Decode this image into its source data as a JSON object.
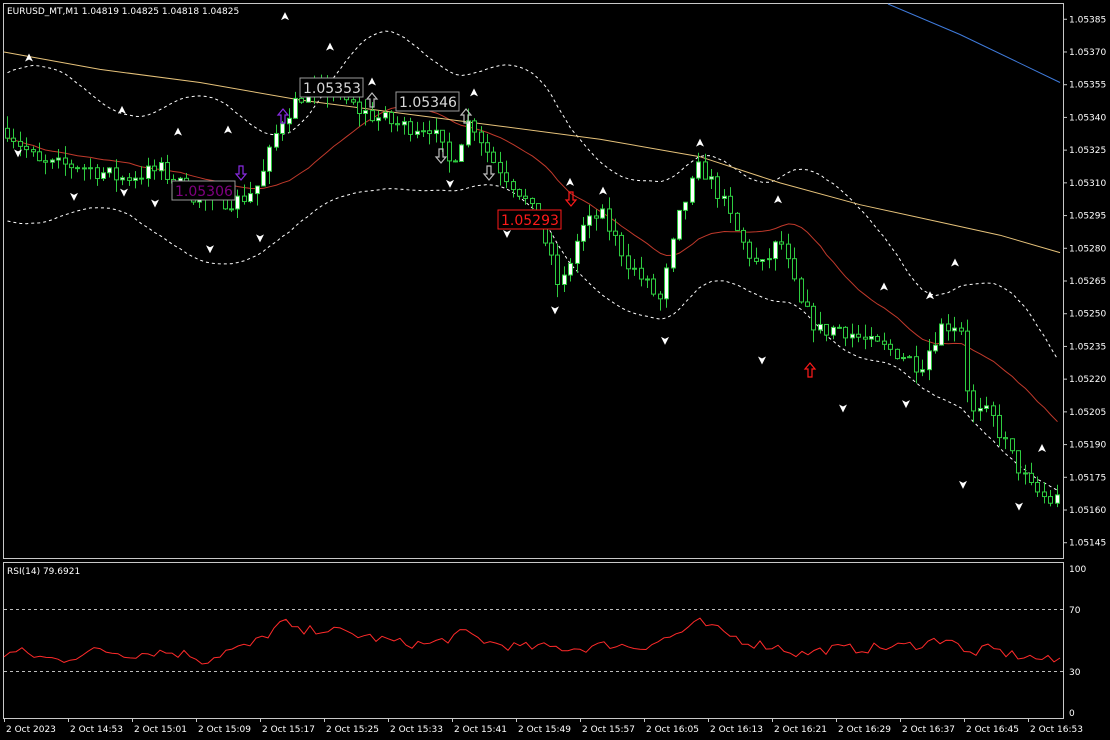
{
  "header": {
    "symbol_info": "EURUSD_MT,M1  1.04819 1.04825 1.04818 1.04825"
  },
  "main_chart": {
    "price_labels": [
      "1.05385",
      "1.05370",
      "1.05355",
      "1.05340",
      "1.05325",
      "1.05310",
      "1.05295",
      "1.05280",
      "1.05265",
      "1.05250",
      "1.05235",
      "1.05220",
      "1.05205",
      "1.05190",
      "1.05175",
      "1.05160",
      "1.05145"
    ],
    "price_range": [
      1.05138,
      1.05392
    ],
    "tags": [
      {
        "text": "1.05353",
        "price": 1.05353,
        "color": "#d8d8d8",
        "border": "#9a9a9a"
      },
      {
        "text": "1.05346",
        "price": 1.05346,
        "color": "#d8d8d8",
        "border": "#9a9a9a"
      },
      {
        "text": "1.05306",
        "price": 1.05306,
        "color": "#800080",
        "border": "#9a9a9a"
      },
      {
        "text": "1.05293",
        "price": 1.05293,
        "color": "#ff1a1a",
        "border": "#ff1a1a"
      }
    ],
    "candle_color": "#2ecc40",
    "bull_fill": "#ffffff",
    "bear_fill": "#000000",
    "ma_fast_color": "#c0392b",
    "ma_slow_color": "#e6c27a",
    "ma_long_color": "#3f7bdc"
  },
  "rsi_panel": {
    "label": "RSI(14) 79.6921",
    "level_labels": [
      "100",
      "70",
      "30",
      "0"
    ],
    "line_color": "#ff2a2a"
  },
  "time_axis": {
    "labels": [
      "2 Oct 2023",
      "2 Oct 14:53",
      "2 Oct 15:01",
      "2 Oct 15:09",
      "2 Oct 15:17",
      "2 Oct 15:25",
      "2 Oct 15:33",
      "2 Oct 15:41",
      "2 Oct 15:49",
      "2 Oct 15:57",
      "2 Oct 16:05",
      "2 Oct 16:13",
      "2 Oct 16:21",
      "2 Oct 16:29",
      "2 Oct 16:37",
      "2 Oct 16:45",
      "2 Oct 16:53"
    ]
  }
}
